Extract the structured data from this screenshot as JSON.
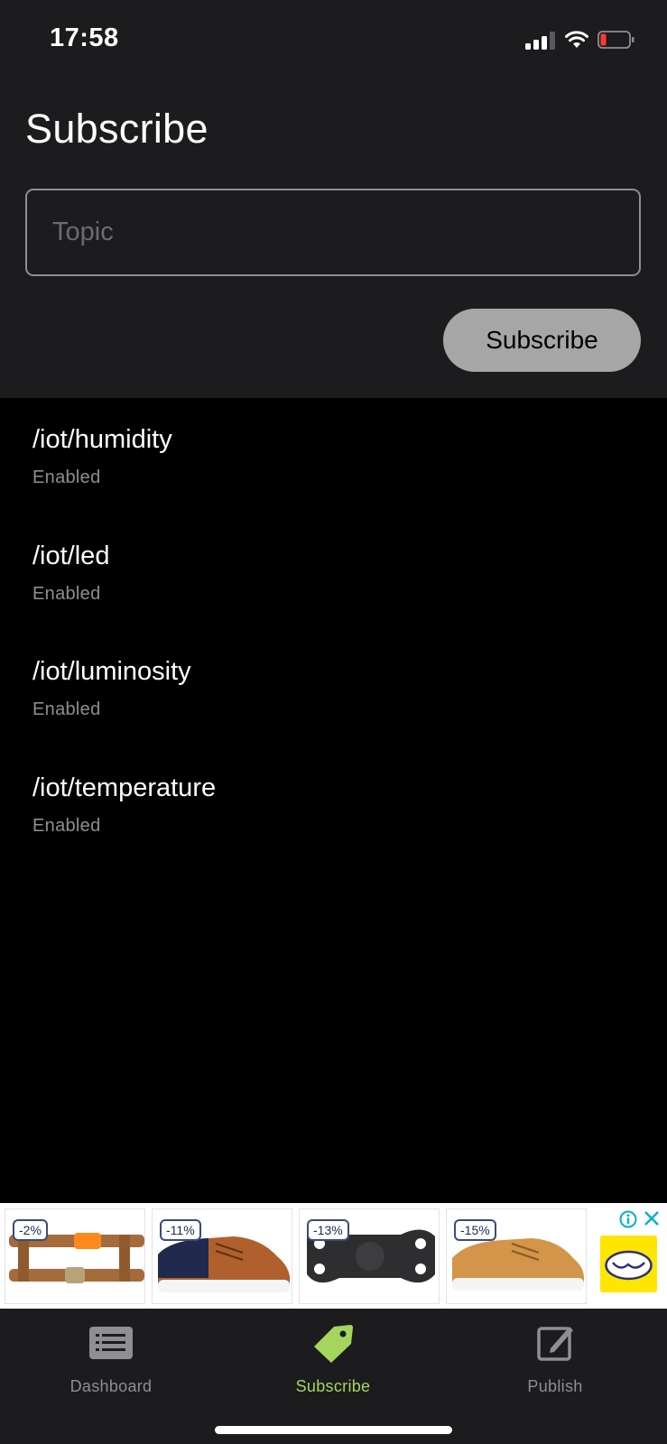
{
  "status_bar": {
    "time": "17:58",
    "icons": [
      "cellular-signal-icon",
      "wifi-icon",
      "battery-low-icon"
    ],
    "battery_color": "#ff3b30"
  },
  "header": {
    "title": "Subscribe"
  },
  "form": {
    "topic_value": "",
    "topic_placeholder": "Topic",
    "subscribe_label": "Subscribe"
  },
  "topics": [
    {
      "name": "/iot/humidity",
      "status": "Enabled"
    },
    {
      "name": "/iot/led",
      "status": "Enabled"
    },
    {
      "name": "/iot/luminosity",
      "status": "Enabled"
    },
    {
      "name": "/iot/temperature",
      "status": "Enabled"
    }
  ],
  "ad": {
    "products": [
      {
        "discount": "-2%",
        "image": "orange-pipe-fitting"
      },
      {
        "discount": "-11%",
        "image": "navy-brown-sneaker"
      },
      {
        "discount": "-13%",
        "image": "black-motorcycle-part"
      },
      {
        "discount": "-15%",
        "image": "tan-sneaker"
      }
    ],
    "icons": [
      "ad-info-icon",
      "ad-close-icon",
      "mercado-libre-logo"
    ],
    "accent_color": "#00aecd"
  },
  "tabs": [
    {
      "label": "Dashboard",
      "icon": "list-icon",
      "active": false
    },
    {
      "label": "Subscribe",
      "icon": "tag-icon",
      "active": true
    },
    {
      "label": "Publish",
      "icon": "compose-icon",
      "active": false
    }
  ],
  "colors": {
    "header_bg": "#1c1c1e",
    "background": "#000000",
    "active_tab": "#a4d65e",
    "inactive_tab": "#8e8e93",
    "button_bg": "#a6a6a6"
  }
}
